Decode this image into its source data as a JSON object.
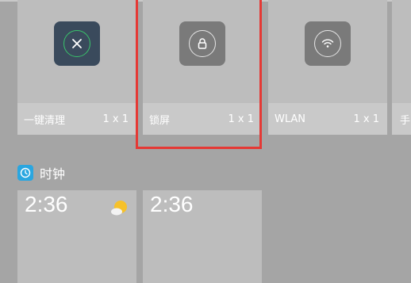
{
  "tiles": [
    {
      "label": "一键清理",
      "size": "1 x 1",
      "icon": "close-icon",
      "bg": "#3a4a5c"
    },
    {
      "label": "锁屏",
      "size": "1 x 1",
      "icon": "lock-icon",
      "bg": "#7a7a7a"
    },
    {
      "label": "WLAN",
      "size": "1 x 1",
      "icon": "wifi-icon",
      "bg": "#7a7a7a"
    },
    {
      "label": "手",
      "size": "",
      "icon": "",
      "bg": ""
    }
  ],
  "section": {
    "title": "时钟",
    "icon": "clock-icon"
  },
  "clock_cards": [
    {
      "time": "2:36",
      "weather_icon": "sun-cloud-icon"
    },
    {
      "time": "2:36"
    }
  ],
  "colors": {
    "highlight": "#e53935",
    "accent_green": "#2ecc71",
    "clock_badge": "#2aa6e0"
  }
}
